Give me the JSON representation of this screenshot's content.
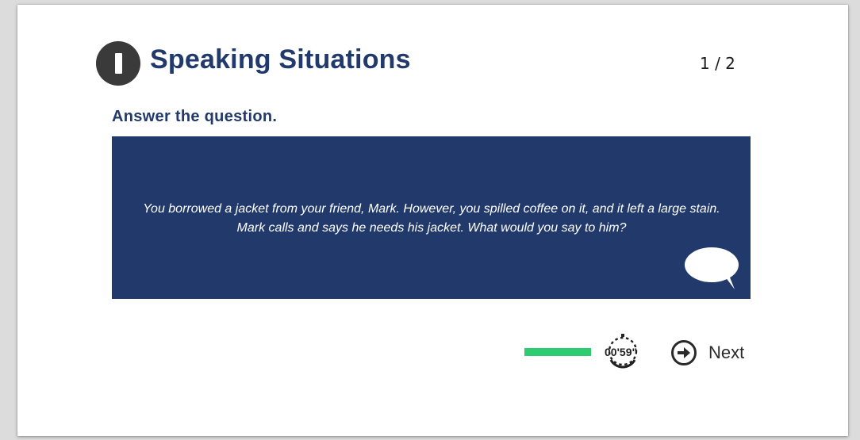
{
  "header": {
    "section_icon": "roman-numeral-one-badge",
    "title": "Speaking Situations",
    "page_counter": "1 / 2"
  },
  "instruction": "Answer the question.",
  "question": {
    "text": "You borrowed a jacket from your friend, Mark. However, you spilled coffee on it, and it left a large stain. Mark calls and says he needs his jacket. What would you say to him?",
    "icon": "speech-bubble-icon"
  },
  "footer": {
    "progress_fraction": 1.0,
    "timer_icon": "stopwatch-icon",
    "timer_text": "00'59\"",
    "next_icon": "arrow-right-circle-icon",
    "next_label": "Next"
  },
  "colors": {
    "navy": "#223a6b",
    "badge": "#3a3a3a",
    "progress": "#2ecc71",
    "background": "#ffffff"
  }
}
